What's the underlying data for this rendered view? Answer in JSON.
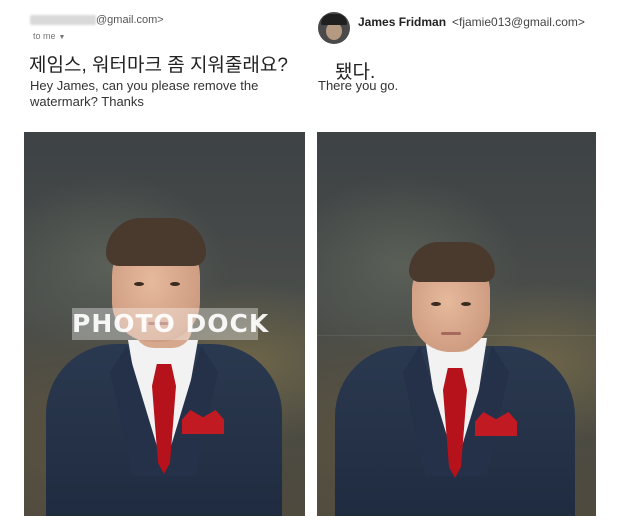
{
  "left": {
    "sender_email_suffix": "@gmail.com>",
    "recipient": "to me",
    "subject_korean": "제임스, 워터마크 좀 지워줄래요?",
    "message_english": "Hey James, can you please remove the watermark? Thanks",
    "watermark_text": "PHOTO DOCK"
  },
  "right": {
    "sender_name": "James Fridman",
    "sender_email": "<fjamie013@gmail.com>",
    "reply_korean": "됐다.",
    "reply_english": "There you go."
  },
  "icons": {
    "dropdown": "chevron-down-icon",
    "avatar": "avatar"
  },
  "colors": {
    "tie": "#b5121b",
    "suit": "#1e2a3e",
    "background": "#ffffff"
  }
}
